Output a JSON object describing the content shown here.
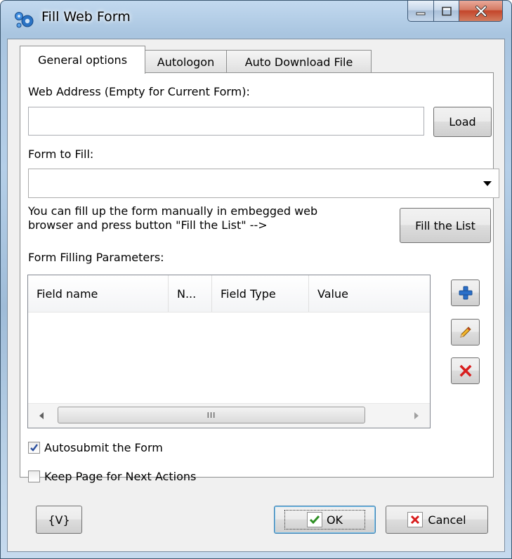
{
  "window": {
    "title": "Fill Web Form",
    "minimize_glyph": "_",
    "maximize_glyph": "□",
    "close_glyph": "X"
  },
  "tabs": [
    {
      "label": "General options",
      "active": true
    },
    {
      "label": "Autologon",
      "active": false
    },
    {
      "label": "Auto Download File",
      "active": false
    }
  ],
  "general": {
    "web_address_label": "Web Address (Empty for Current Form):",
    "web_address_value": "",
    "load_button": "Load",
    "form_to_fill_label": "Form to Fill:",
    "form_to_fill_value": "",
    "hint_line1": "You can fill up the form manually in embegged web",
    "hint_line2": "browser and press button \"Fill the List\" -->",
    "fill_list_button": "Fill the List",
    "params_label": "Form Filling Parameters:",
    "columns": [
      "Field name",
      "N...",
      "Field Type",
      "Value"
    ],
    "rows": [],
    "scroll_thumb_grip": "III",
    "autosubmit_label": "Autosubmit the Form",
    "autosubmit_checked": true,
    "keep_page_label": "Keep Page for Next Actions",
    "keep_page_checked": false
  },
  "footer": {
    "variables_button": "{V}",
    "ok_button": "OK",
    "cancel_button": "Cancel"
  },
  "icons": {
    "app": "gears-icon",
    "add": "plus-icon",
    "edit": "pencil-icon",
    "delete": "red-x-icon",
    "ok": "green-check-icon",
    "cancel": "red-x-icon"
  },
  "colors": {
    "accent_blue": "#2a6fc9",
    "check_green": "#2d8f23",
    "delete_red": "#d81e1e",
    "close_red": "#c4452a"
  }
}
